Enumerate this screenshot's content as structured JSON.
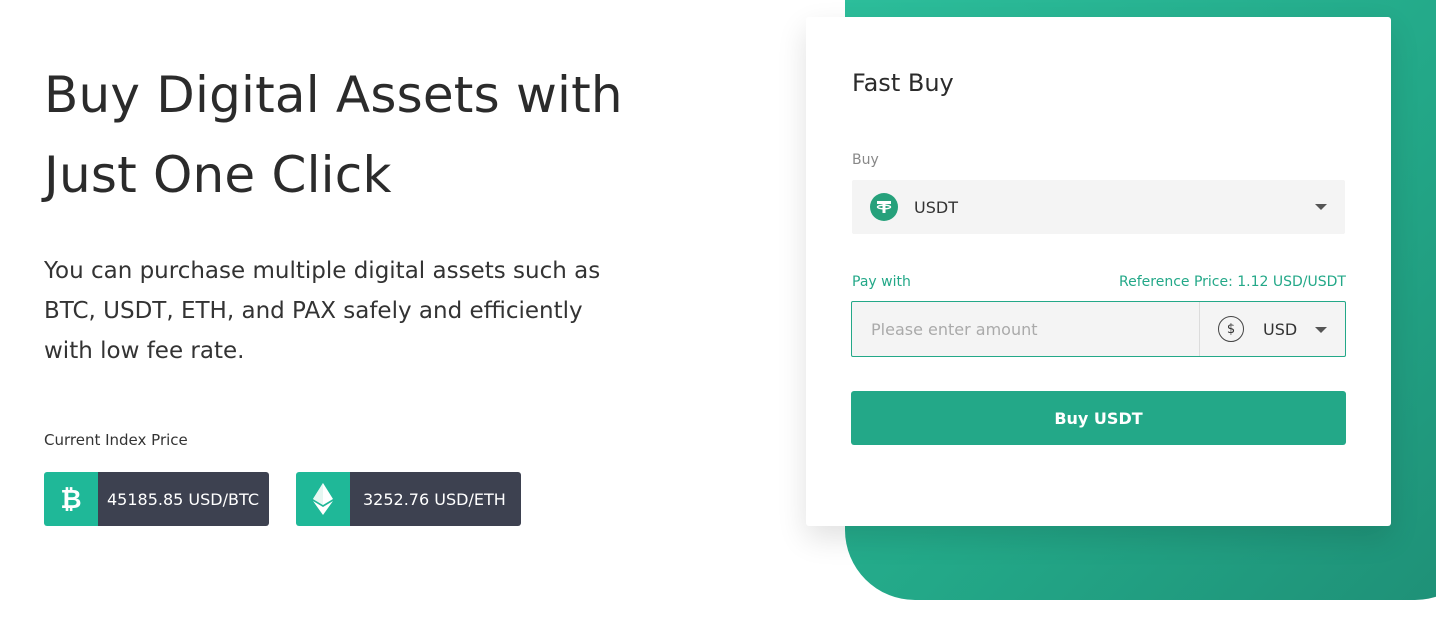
{
  "hero": {
    "title_line1": "Buy Digital Assets with",
    "title_line2": "Just One Click",
    "description": "You can purchase multiple digital assets such as BTC, USDT, ETH, and PAX safely and efficiently with low fee rate."
  },
  "index_price": {
    "label": "Current Index Price",
    "tickers": [
      {
        "icon": "bitcoin-icon",
        "value": "45185.85 USD/BTC"
      },
      {
        "icon": "ethereum-icon",
        "value": "3252.76 USD/ETH"
      }
    ]
  },
  "fast_buy": {
    "title": "Fast Buy",
    "buy_label": "Buy",
    "buy_coin": "USDT",
    "buy_coin_icon": "tether-icon",
    "pay_label": "Pay with",
    "reference_price": "Reference Price: 1.12 USD/USDT",
    "amount_placeholder": "Please enter amount",
    "pay_currency": "USD",
    "pay_currency_icon": "dollar-icon",
    "button_label": "Buy USDT"
  },
  "colors": {
    "accent": "#23a888",
    "ticker_bg": "#3d4150",
    "ticker_icon_bg": "#1fb898"
  }
}
